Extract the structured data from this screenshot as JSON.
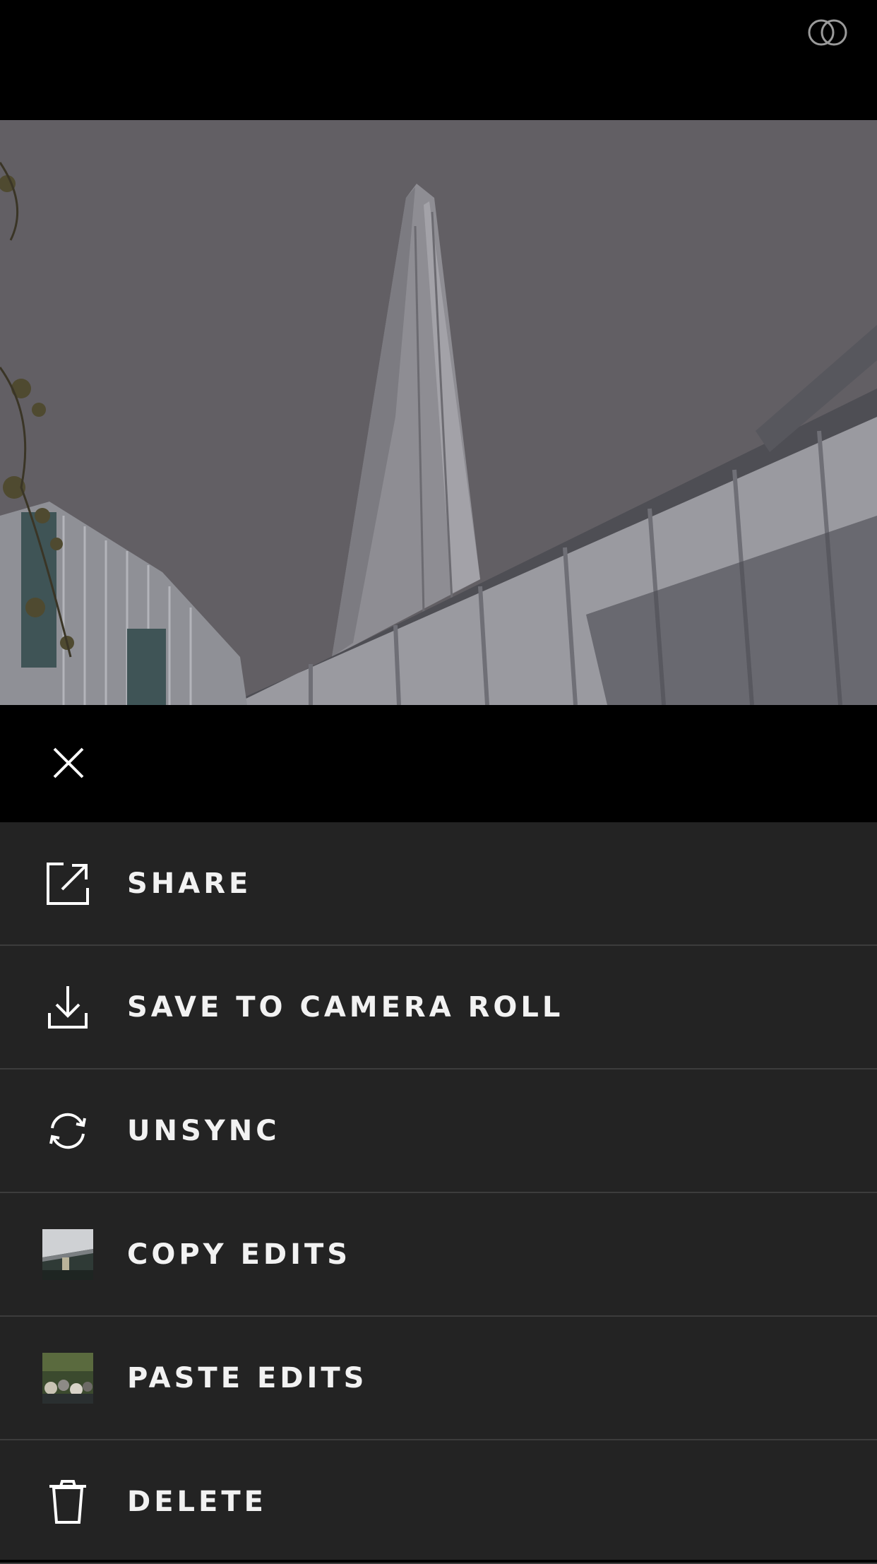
{
  "header": {
    "compare_icon": "compare-circles-icon"
  },
  "photo": {
    "description_icon": "photo-preview"
  },
  "close": {
    "icon": "close-icon"
  },
  "menu": {
    "items": [
      {
        "label": "SHARE",
        "icon": "share-icon"
      },
      {
        "label": "SAVE TO CAMERA ROLL",
        "icon": "download-icon"
      },
      {
        "label": "UNSYNC",
        "icon": "sync-icon"
      },
      {
        "label": "COPY EDITS",
        "icon": "copy-edits-thumbnail"
      },
      {
        "label": "PASTE EDITS",
        "icon": "paste-edits-thumbnail"
      },
      {
        "label": "DELETE",
        "icon": "trash-icon"
      }
    ]
  },
  "colors": {
    "background": "#000000",
    "menu_background": "#232323",
    "divider": "#3c3c3c",
    "text": "#f2f2f2"
  }
}
